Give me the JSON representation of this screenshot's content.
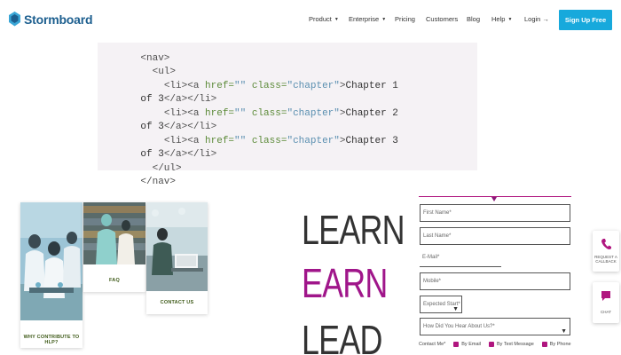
{
  "brand": {
    "name": "Stormboard",
    "color": "#1d5f8f"
  },
  "nav": {
    "items": [
      {
        "label": "Product",
        "has_caret": true
      },
      {
        "label": "Enterprise",
        "has_caret": true
      },
      {
        "label": "Pricing",
        "has_caret": false
      },
      {
        "label": "Customers",
        "has_caret": false
      },
      {
        "label": "Blog",
        "has_caret": false
      },
      {
        "label": "Help",
        "has_caret": true
      },
      {
        "label": "Login →",
        "has_caret": false
      }
    ],
    "signup_label": "Sign Up Free",
    "signup_color": "#17a9dc"
  },
  "code": {
    "lines": [
      {
        "indent": "    ",
        "parts": [
          [
            "tag",
            "<nav>"
          ]
        ]
      },
      {
        "indent": "      ",
        "parts": [
          [
            "tag",
            "<ul>"
          ]
        ]
      },
      {
        "indent": "        ",
        "parts": [
          [
            "tag",
            "<li><a "
          ],
          [
            "attr",
            "href="
          ],
          [
            "val",
            "\"\" "
          ],
          [
            "attr",
            "class="
          ],
          [
            "val",
            "\"chapter\""
          ],
          [
            "tag",
            ">"
          ],
          [
            "txt",
            "Chapter 1"
          ]
        ]
      },
      {
        "indent": "    ",
        "parts": [
          [
            "txt",
            "of 3"
          ],
          [
            "tag",
            "</a></li>"
          ]
        ]
      },
      {
        "indent": "        ",
        "parts": [
          [
            "tag",
            "<li><a "
          ],
          [
            "attr",
            "href="
          ],
          [
            "val",
            "\"\" "
          ],
          [
            "attr",
            "class="
          ],
          [
            "val",
            "\"chapter\""
          ],
          [
            "tag",
            ">"
          ],
          [
            "txt",
            "Chapter 2"
          ]
        ]
      },
      {
        "indent": "    ",
        "parts": [
          [
            "txt",
            "of 3"
          ],
          [
            "tag",
            "</a></li>"
          ]
        ]
      },
      {
        "indent": "        ",
        "parts": [
          [
            "tag",
            "<li><a "
          ],
          [
            "attr",
            "href="
          ],
          [
            "val",
            "\"\" "
          ],
          [
            "attr",
            "class="
          ],
          [
            "val",
            "\"chapter\""
          ],
          [
            "tag",
            ">"
          ],
          [
            "txt",
            "Chapter 3"
          ]
        ]
      },
      {
        "indent": "    ",
        "parts": [
          [
            "txt",
            "of 3"
          ],
          [
            "tag",
            "</a></li>"
          ]
        ]
      },
      {
        "indent": "      ",
        "parts": [
          [
            "tag",
            "</ul>"
          ]
        ]
      },
      {
        "indent": "    ",
        "parts": [
          [
            "tag",
            "</nav>"
          ]
        ]
      }
    ]
  },
  "collage": {
    "cards": [
      {
        "caption": "WHY CONTRIBUTE TO HLP?"
      },
      {
        "caption": "FAQ"
      },
      {
        "caption": "CONTACT US"
      }
    ]
  },
  "slogan": {
    "lines": [
      {
        "text": "LEARN",
        "color": "#333333"
      },
      {
        "text": "EARN",
        "color": "#a0168a"
      },
      {
        "text": "LEAD",
        "color": "#333333"
      }
    ]
  },
  "form": {
    "first_name": "First Name*",
    "last_name": "Last Name*",
    "email": "E-Mail*",
    "mobile": "Mobile*",
    "expected_start": "Expected Start*",
    "heard_about": "How Did You Hear About Us?*",
    "contact_me": "Contact Me*",
    "by_email": "By Email",
    "by_text": "By Text Message",
    "by_phone": "By Phone",
    "accent_color": "#b0167f"
  },
  "widgets": [
    {
      "icon": "phone-icon",
      "label": "REQUEST A CALLBACK"
    },
    {
      "icon": "chat-icon",
      "label": "CHAT"
    }
  ]
}
